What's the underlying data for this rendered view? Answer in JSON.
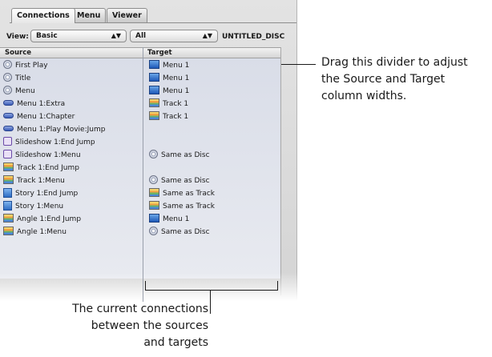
{
  "tabs": [
    {
      "label": "Connections",
      "active": true
    },
    {
      "label": "Menu",
      "active": false
    },
    {
      "label": "Viewer",
      "active": false
    }
  ],
  "toolbar": {
    "view_label": "View:",
    "view_value": "Basic",
    "filter_value": "All",
    "disc_name": "UNTITLED_DISC"
  },
  "columns": {
    "source": "Source",
    "target": "Target"
  },
  "rows": [
    {
      "source": "First Play",
      "source_icon": "disc-icon",
      "target": "Menu 1",
      "target_icon": "menu-icon"
    },
    {
      "source": "Title",
      "source_icon": "disc-icon",
      "target": "Menu 1",
      "target_icon": "menu-icon"
    },
    {
      "source": "Menu",
      "source_icon": "disc-icon",
      "target": "Menu 1",
      "target_icon": "menu-icon"
    },
    {
      "source": "Menu 1:Extra",
      "source_icon": "button-icon",
      "target": "Track 1",
      "target_icon": "track-icon"
    },
    {
      "source": "Menu 1:Chapter",
      "source_icon": "button-icon",
      "target": "Track 1",
      "target_icon": "track-icon"
    },
    {
      "source": "Menu 1:Play Movie:Jump",
      "source_icon": "button-icon",
      "target": "",
      "target_icon": ""
    },
    {
      "source": "Slideshow 1:End Jump",
      "source_icon": "slideshow-icon",
      "target": "",
      "target_icon": ""
    },
    {
      "source": "Slideshow 1:Menu",
      "source_icon": "slideshow-icon",
      "target": "Same as Disc",
      "target_icon": "disc-icon"
    },
    {
      "source": "Track 1:End Jump",
      "source_icon": "track-icon",
      "target": "",
      "target_icon": ""
    },
    {
      "source": "Track 1:Menu",
      "source_icon": "track-icon",
      "target": "Same as Disc",
      "target_icon": "disc-icon"
    },
    {
      "source": "Story 1:End Jump",
      "source_icon": "story-icon",
      "target": "Same as Track",
      "target_icon": "track-icon"
    },
    {
      "source": "Story 1:Menu",
      "source_icon": "story-icon",
      "target": "Same as Track",
      "target_icon": "track-icon"
    },
    {
      "source": "Angle 1:End Jump",
      "source_icon": "track-icon",
      "target": "Menu 1",
      "target_icon": "menu-icon"
    },
    {
      "source": "Angle 1:Menu",
      "source_icon": "track-icon",
      "target": "Same as Disc",
      "target_icon": "disc-icon"
    }
  ],
  "callouts": {
    "divider": [
      "Drag this divider to adjust",
      "the Source and Target",
      "column widths."
    ],
    "connections": [
      "The current connections",
      "between the sources",
      "and targets"
    ]
  }
}
